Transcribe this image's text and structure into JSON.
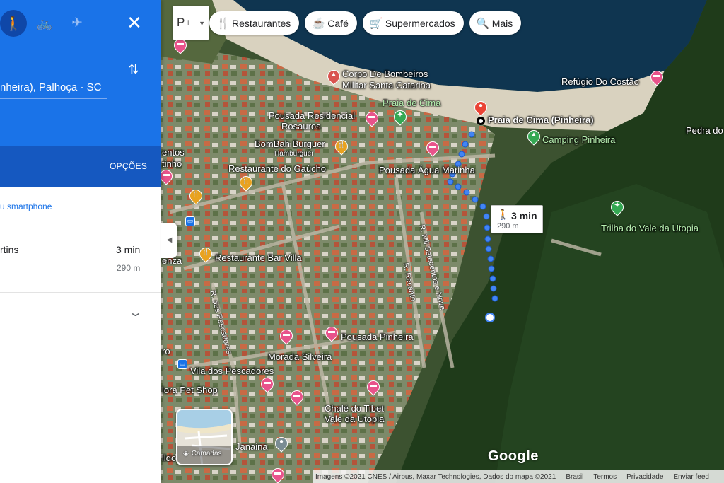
{
  "panel": {
    "modes": {
      "walk_icon": "🚶",
      "bike_icon": "🚲",
      "plane_icon": "✈",
      "close_icon": "✕"
    },
    "destination_partial": "nheira), Palhoça - SC",
    "options_label": "OPÇÕES",
    "send_to_phone_partial": "u smartphone",
    "route": {
      "name_partial": "rtins",
      "time": "3 min",
      "distance": "290 m"
    }
  },
  "categories": [
    {
      "label": "Restaurantes",
      "icon": "fork-knife-icon",
      "glyph": "🍴"
    },
    {
      "label": "Café",
      "icon": "coffee-icon",
      "glyph": "☕"
    },
    {
      "label": "Supermercados",
      "icon": "cart-icon",
      "glyph": "🛒"
    },
    {
      "label": "Mais",
      "icon": "search-icon",
      "glyph": "🔍"
    }
  ],
  "partial_button_label": "P",
  "route_callout": {
    "time": "3 min",
    "distance": "290 m"
  },
  "places": {
    "bombeiros_1": "Corpo De Bombeiros",
    "bombeiros_2": "Militar Santa Catarina",
    "praia_cima": "Praia de Cima",
    "pousada_res_1": "Pousada Residencial",
    "pousada_res_2": "Rosauros",
    "refugio": "Refúgio Do Costão",
    "destination": "Praia de Cima (Pinheira)",
    "pedra": "Pedra do",
    "bombah_1": "BomBah Burguer",
    "bombah_2": "Hamburguer",
    "camping": "Camping Pinheira",
    "restaurante_gaucho": "Restaurante do Gaúcho",
    "agua_marinha": "Pousada Água Marinha",
    "trilha": "Trilha do Vale da Utopia",
    "bar_villa": "Restaurante Bar Villa",
    "pousada_pinheira": "Pousada Pinheira",
    "morada_silveira": "Morada Silveira",
    "vila_pescadores": "Vila dos Pescadores",
    "pet_shop": "lora Pet Shop",
    "chale_1": "Chalé do Tibet",
    "chale_2": "Vale da Utopia",
    "janaina": "Janaina",
    "entos": "entos",
    "tinho": "tinho",
    "enza": "enza",
    "ro": "ro",
    "ildo": "ildo"
  },
  "streets": {
    "mil_setecentos": "R. Mil Setecentos e Nove",
    "recanto": "R. Recanto",
    "pescadores": "R. dos Pescadores"
  },
  "layers_label": "Camadas",
  "google_logo": "Google",
  "footer": {
    "imagery": "Imagens ©2021 CNES / Airbus, Maxar Technologies, Dados do mapa ©2021",
    "country": "Brasil",
    "terms": "Termos",
    "privacy": "Privacidade",
    "feedback": "Enviar feed"
  }
}
